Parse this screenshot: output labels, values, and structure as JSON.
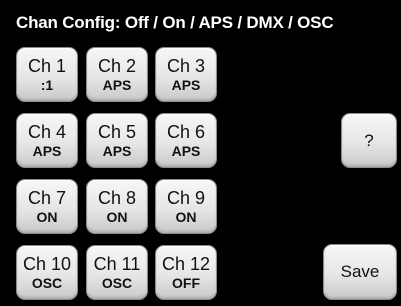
{
  "title": "Chan Config: Off / On / APS / DMX / OSC",
  "channels": [
    {
      "name": "Ch 1",
      "mode": ":1"
    },
    {
      "name": "Ch 2",
      "mode": "APS"
    },
    {
      "name": "Ch 3",
      "mode": "APS"
    },
    {
      "name": "Ch 4",
      "mode": "APS"
    },
    {
      "name": "Ch 5",
      "mode": "APS"
    },
    {
      "name": "Ch 6",
      "mode": "APS"
    },
    {
      "name": "Ch 7",
      "mode": "ON"
    },
    {
      "name": "Ch 8",
      "mode": "ON"
    },
    {
      "name": "Ch 9",
      "mode": "ON"
    },
    {
      "name": "Ch 10",
      "mode": "OSC"
    },
    {
      "name": "Ch 11",
      "mode": "OSC"
    },
    {
      "name": "Ch 12",
      "mode": "OFF"
    }
  ],
  "help_button": "?",
  "save_button": "Save",
  "colors": {
    "background": "#000000",
    "button": "#e6e6e6",
    "text": "#111111",
    "title": "#ffffff"
  }
}
